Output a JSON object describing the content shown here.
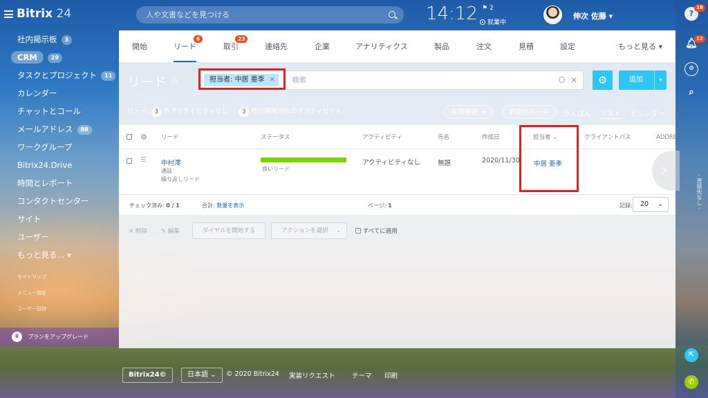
{
  "header": {
    "logo_main": "Bitrix",
    "logo_num": " 24",
    "search_placeholder": "人や文書などを見つける",
    "time": "14:12",
    "flag_count": "2",
    "work_status": "就業中",
    "user_name": "伸次 佐藤"
  },
  "sidebar": {
    "items": [
      {
        "label": "社内掲示板",
        "count": "3"
      },
      {
        "label": "CRM",
        "count": "29"
      },
      {
        "label": "タスクとプロジェクト",
        "count": "11"
      },
      {
        "label": "カレンダー"
      },
      {
        "label": "チャットとコール"
      },
      {
        "label": "メールアドレス",
        "count": "88"
      },
      {
        "label": "ワークグループ"
      },
      {
        "label": "Bitrix24.Drive"
      },
      {
        "label": "時間とレポート"
      },
      {
        "label": "コンタクトセンター"
      },
      {
        "label": "サイト"
      },
      {
        "label": "ユーザー"
      },
      {
        "label": "もっと見る..."
      }
    ],
    "small": [
      "サイトマップ",
      "メニュー設定",
      "ユーザー招待"
    ],
    "upgrade": "プランをアップグレード"
  },
  "tabs": [
    {
      "label": "開始"
    },
    {
      "label": "リード",
      "badge": "6"
    },
    {
      "label": "取引",
      "badge": "23"
    },
    {
      "label": "連絡先"
    },
    {
      "label": "企業"
    },
    {
      "label": "アナリティクス"
    },
    {
      "label": "製品"
    },
    {
      "label": "注文"
    },
    {
      "label": "見積"
    },
    {
      "label": "設定"
    },
    {
      "label": "もっと見る"
    }
  ],
  "page": {
    "title": "リード",
    "filter_chip": "担当者: 中居 亜季",
    "filter_placeholder": "検索",
    "add_label": "追加",
    "info_prefix": "リード:",
    "no_activity_count": "3",
    "no_activity_label": "件アクティビティなし",
    "overdue_count": "3",
    "overdue_label": "件の期限切れのアクティビティ",
    "ext_button": "拡張機能",
    "automation_button": "自動化ルール",
    "views": [
      "かんばん",
      "リスト",
      "カレンダー"
    ]
  },
  "grid": {
    "headers": [
      "リード",
      "ステータス",
      "アクティビティ",
      "氏名",
      "作成日",
      "担当者",
      "クライアントパス",
      "ADDRE"
    ],
    "row": {
      "lead_name": "中村澪",
      "lead_sub1": "通話",
      "lead_sub2": "繰り返しリード",
      "status": "良いリード",
      "activity": "アクティビティなし",
      "name": "無題",
      "created": "2020/11/30",
      "responsible": "中居 亜季"
    },
    "footer": {
      "checked_label": "チェック済み:",
      "checked_value": "0 / 1",
      "total_label": "合計:",
      "total_link": "数量を表示",
      "page_label": "ページ:",
      "page_value": "1",
      "records_label": "記録:",
      "records_value": "20"
    }
  },
  "actions": {
    "delete": "削除",
    "edit": "編集",
    "dial": "ダイヤルを開始する",
    "select_action": "アクションを選択",
    "apply_all": "すべてに適用"
  },
  "rightbar": {
    "help_badge": "18",
    "bell_badge": "12",
    "vertical_text": "- 連絡先なし -"
  },
  "bottom": {
    "brand": "Bitrix24",
    "lang": "日本語",
    "copyright": "© 2020 Bitrix24",
    "request": "実装リクエスト",
    "theme": "テーマ",
    "print": "印刷"
  }
}
